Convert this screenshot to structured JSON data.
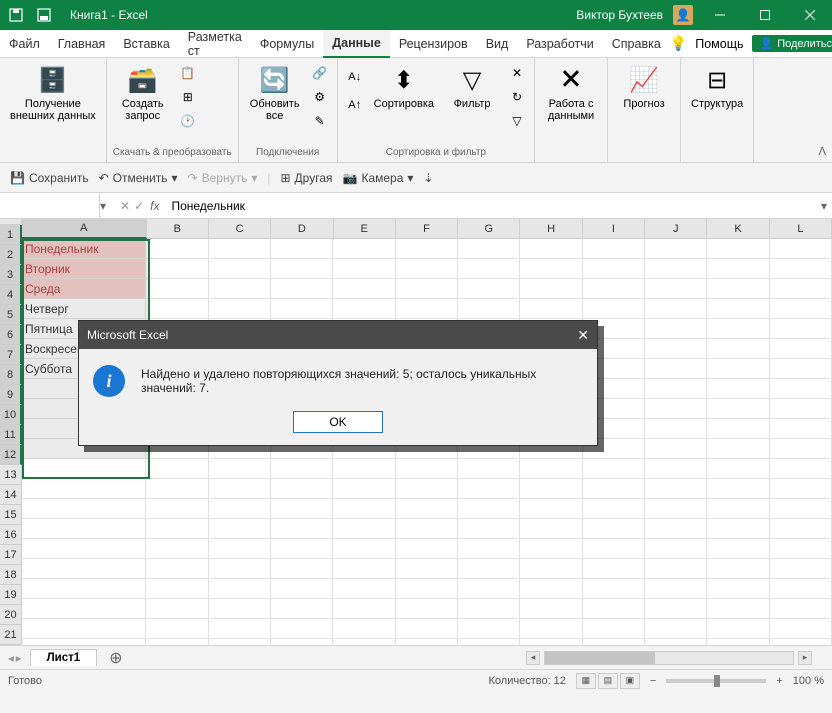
{
  "titlebar": {
    "title": "Книга1 - Excel",
    "user": "Виктор Бухтеев"
  },
  "menu": {
    "file": "Файл",
    "home": "Главная",
    "insert": "Вставка",
    "layout": "Разметка ст",
    "formulas": "Формулы",
    "data": "Данные",
    "review": "Рецензиров",
    "view": "Вид",
    "developer": "Разработчи",
    "help": "Справка",
    "tellme": "Помощь",
    "share": "Поделиться"
  },
  "ribbon": {
    "group1": {
      "btn": "Получение\nвнешних данных",
      "label": ""
    },
    "group2": {
      "btn": "Создать\nзапрос",
      "label": "Скачать & преобразовать"
    },
    "group3": {
      "btn": "Обновить\nвсе",
      "label": "Подключения"
    },
    "group4": {
      "sort": "Сортировка",
      "filter": "Фильтр",
      "label": "Сортировка и фильтр"
    },
    "group5": {
      "btn": "Работа с\nданными",
      "label": ""
    },
    "group6": {
      "btn": "Прогноз",
      "label": ""
    },
    "group7": {
      "btn": "Структура",
      "label": ""
    }
  },
  "quickbar": {
    "save": "Сохранить",
    "undo": "Отменить",
    "redo": "Вернуть",
    "other": "Другая",
    "camera": "Камера"
  },
  "formulabar": {
    "namebox": "",
    "value": "Понедельник"
  },
  "columns": [
    "A",
    "B",
    "C",
    "D",
    "E",
    "F",
    "G",
    "H",
    "I",
    "J",
    "K",
    "L"
  ],
  "rows_visible": 21,
  "cells": {
    "a": [
      "Понедельник",
      "Вторник",
      "Среда",
      "Четверг",
      "Пятница",
      "Воскресенье",
      "Суббота"
    ]
  },
  "sheet_tab": "Лист1",
  "statusbar": {
    "ready": "Готово",
    "count": "Количество: 12",
    "zoom": "100 %"
  },
  "dialog": {
    "title": "Microsoft Excel",
    "message": "Найдено и удалено повторяющихся значений: 5; осталось уникальных значений: 7.",
    "ok": "OK"
  }
}
